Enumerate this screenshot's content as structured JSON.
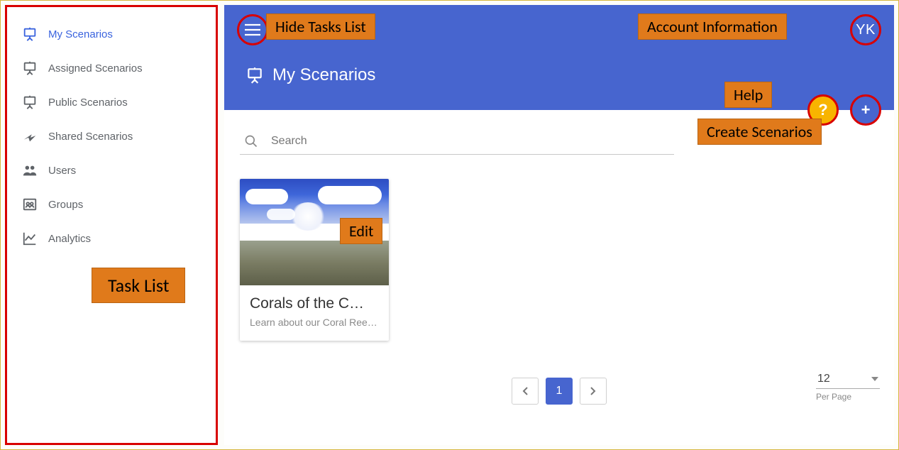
{
  "sidebar": {
    "items": [
      {
        "label": "My Scenarios",
        "icon": "easel",
        "active": true
      },
      {
        "label": "Assigned Scenarios",
        "icon": "easel",
        "active": false
      },
      {
        "label": "Public Scenarios",
        "icon": "easel",
        "active": false
      },
      {
        "label": "Shared Scenarios",
        "icon": "share",
        "active": false
      },
      {
        "label": "Users",
        "icon": "users",
        "active": false
      },
      {
        "label": "Groups",
        "icon": "groups",
        "active": false
      },
      {
        "label": "Analytics",
        "icon": "chart",
        "active": false
      }
    ]
  },
  "header": {
    "avatar_initials": "YK",
    "page_title": "My Scenarios"
  },
  "actions": {
    "help_symbol": "?",
    "add_symbol": "+"
  },
  "search": {
    "placeholder": "Search",
    "value": ""
  },
  "scenarios": [
    {
      "title": "Corals of the C…",
      "subtitle": "Learn about our Coral Ree…"
    }
  ],
  "pagination": {
    "current_page": "1",
    "per_page_value": "12",
    "per_page_label": "Per Page"
  },
  "annotations": {
    "hide_tasks": "Hide Tasks List",
    "account_info": "Account Information",
    "help": "Help",
    "create_scenarios": "Create Scenarios",
    "edit": "Edit",
    "task_list": "Task List"
  }
}
